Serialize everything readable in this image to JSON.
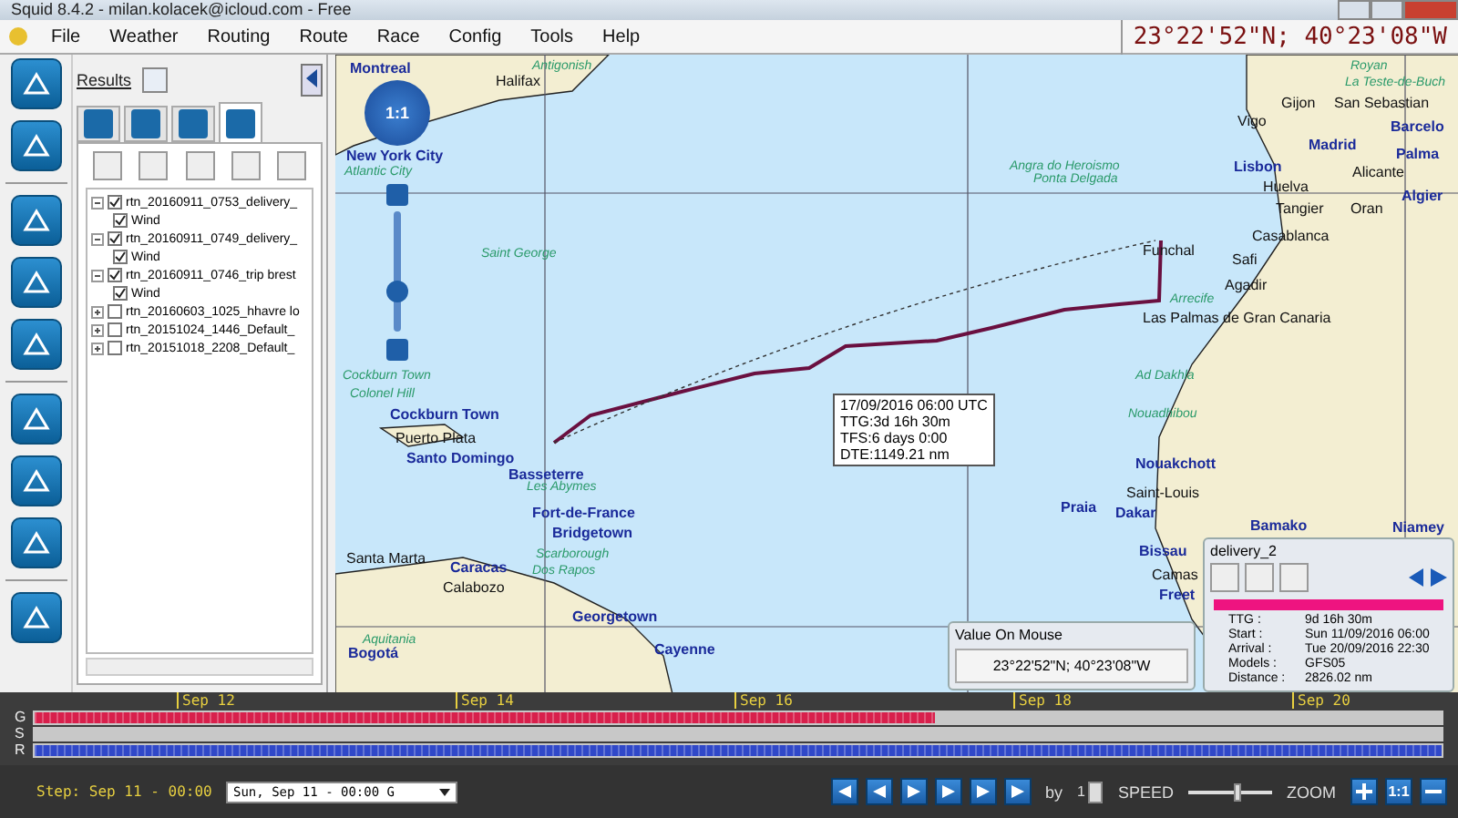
{
  "window": {
    "title": "Squid 8.4.2 - milan.kolacek@icloud.com - Free"
  },
  "menu": [
    "File",
    "Weather",
    "Routing",
    "Route",
    "Race",
    "Config",
    "Tools",
    "Help"
  ],
  "position_readout": "23°22'52\"N; 40°23'08\"W",
  "results_panel": {
    "title": "Results",
    "tabs": [
      {
        "selected": false
      },
      {
        "selected": false
      },
      {
        "selected": false
      },
      {
        "selected": true
      }
    ],
    "tree": [
      {
        "label": "rtn_20160911_0753_delivery_",
        "checked": true,
        "expanded": true,
        "children": [
          {
            "label": "Wind",
            "checked": true
          }
        ]
      },
      {
        "label": "rtn_20160911_0749_delivery_",
        "checked": true,
        "expanded": true,
        "children": [
          {
            "label": "Wind",
            "checked": true
          }
        ]
      },
      {
        "label": "rtn_20160911_0746_trip brest",
        "checked": true,
        "expanded": true,
        "children": [
          {
            "label": "Wind",
            "checked": true
          }
        ]
      },
      {
        "label": "rtn_20160603_1025_hhavre lo",
        "checked": false,
        "expanded": false
      },
      {
        "label": "rtn_20151024_1446_Default_",
        "checked": false,
        "expanded": false
      },
      {
        "label": "rtn_20151018_2208_Default_",
        "checked": false,
        "expanded": false
      }
    ]
  },
  "map": {
    "zoom_label": "1:1",
    "zoom": {
      "level": 0.3
    },
    "labels": [
      {
        "text": "Montreal",
        "kind": "city"
      },
      {
        "text": "Halifax",
        "kind": "town"
      },
      {
        "text": "Antigonish",
        "kind": "minor"
      },
      {
        "text": "New York City",
        "kind": "city"
      },
      {
        "text": "Atlantic City",
        "kind": "minor"
      },
      {
        "text": "Saint George",
        "kind": "minor"
      },
      {
        "text": "Angra do Heroismo",
        "kind": "minor"
      },
      {
        "text": "Ponta Delgada",
        "kind": "minor"
      },
      {
        "text": "Funchal",
        "kind": "town"
      },
      {
        "text": "Arrecife",
        "kind": "minor"
      },
      {
        "text": "Las Palmas de Gran Canaria",
        "kind": "town"
      },
      {
        "text": "Royan",
        "kind": "minor"
      },
      {
        "text": "La Teste-de-Buch",
        "kind": "minor"
      },
      {
        "text": "Gijon",
        "kind": "town"
      },
      {
        "text": "San Sebastian",
        "kind": "town"
      },
      {
        "text": "Vigo",
        "kind": "town"
      },
      {
        "text": "Madrid",
        "kind": "city"
      },
      {
        "text": "Barcelo",
        "kind": "city"
      },
      {
        "text": "Palma",
        "kind": "city"
      },
      {
        "text": "Lisbon",
        "kind": "city"
      },
      {
        "text": "Alicante",
        "kind": "town"
      },
      {
        "text": "Huelva",
        "kind": "town"
      },
      {
        "text": "Algier",
        "kind": "city"
      },
      {
        "text": "Tangier",
        "kind": "town"
      },
      {
        "text": "Oran",
        "kind": "town"
      },
      {
        "text": "Casablanca",
        "kind": "town"
      },
      {
        "text": "Safi",
        "kind": "town"
      },
      {
        "text": "Agadir",
        "kind": "town"
      },
      {
        "text": "Ad Dakhla",
        "kind": "minor"
      },
      {
        "text": "Nouadhibou",
        "kind": "minor"
      },
      {
        "text": "Nouakchott",
        "kind": "city"
      },
      {
        "text": "Saint-Louis",
        "kind": "town"
      },
      {
        "text": "Dakar",
        "kind": "city"
      },
      {
        "text": "Praia",
        "kind": "city"
      },
      {
        "text": "Bissau",
        "kind": "city"
      },
      {
        "text": "Camas",
        "kind": "town"
      },
      {
        "text": "Freet",
        "kind": "city"
      },
      {
        "text": "Bamako",
        "kind": "city"
      },
      {
        "text": "Niamey",
        "kind": "city"
      },
      {
        "text": "Cockburn Town",
        "kind": "minor"
      },
      {
        "text": "Colonel Hill",
        "kind": "minor"
      },
      {
        "text": "Cockburn Town",
        "kind": "city"
      },
      {
        "text": "Puerto Plata",
        "kind": "town"
      },
      {
        "text": "Santo Domingo",
        "kind": "city"
      },
      {
        "text": "Basseterre",
        "kind": "city"
      },
      {
        "text": "Les Abymes",
        "kind": "minor"
      },
      {
        "text": "Fort-de-France",
        "kind": "city"
      },
      {
        "text": "Bridgetown",
        "kind": "city"
      },
      {
        "text": "Santa Marta",
        "kind": "town"
      },
      {
        "text": "Caracas",
        "kind": "city"
      },
      {
        "text": "Scarborough",
        "kind": "minor"
      },
      {
        "text": "Dos Rapos",
        "kind": "minor"
      },
      {
        "text": "Calabozo",
        "kind": "town"
      },
      {
        "text": "Georgetown",
        "kind": "city"
      },
      {
        "text": "Cayenne",
        "kind": "city"
      },
      {
        "text": "Aquitania",
        "kind": "minor"
      },
      {
        "text": "Bogotá",
        "kind": "city"
      }
    ],
    "route_tooltip": [
      "17/09/2016 06:00 UTC",
      "TTG:3d 16h 30m",
      "TFS:6 days 0:00",
      "DTE:1149.21 nm"
    ],
    "value_on_mouse": {
      "title": "Value On Mouse",
      "value": "23°22'52\"N; 40°23'08\"W"
    },
    "route_info": {
      "title": "delivery_2",
      "color": "#ee1480",
      "stats": [
        {
          "label": "TTG :",
          "value": "9d 16h 30m"
        },
        {
          "label": "Start :",
          "value": "Sun 11/09/2016 06:00"
        },
        {
          "label": "Arrival :",
          "value": "Tue 20/09/2016 22:30"
        },
        {
          "label": "Models :",
          "value": "GFS05"
        },
        {
          "label": "Distance :",
          "value": "2826.02 nm"
        }
      ]
    }
  },
  "timeline": {
    "ticks": [
      "Sep 12",
      "Sep 14",
      "Sep 16",
      "Sep 18",
      "Sep 20"
    ],
    "rows": [
      {
        "label": "G",
        "level": 0.64,
        "color": "#d8204c"
      },
      {
        "label": "S"
      },
      {
        "label": "R",
        "level": 1,
        "color": "#3048c8"
      }
    ]
  },
  "controls": {
    "step": "Step: Sep 11 - 00:00",
    "time_select": "Sun, Sep 11 - 00:00 G",
    "by_label": "by",
    "by_value": "1",
    "speed_label": "SPEED",
    "speed": {
      "level": 0.6
    },
    "zoom_label": "ZOOM",
    "zoom_reset": "1:1"
  }
}
